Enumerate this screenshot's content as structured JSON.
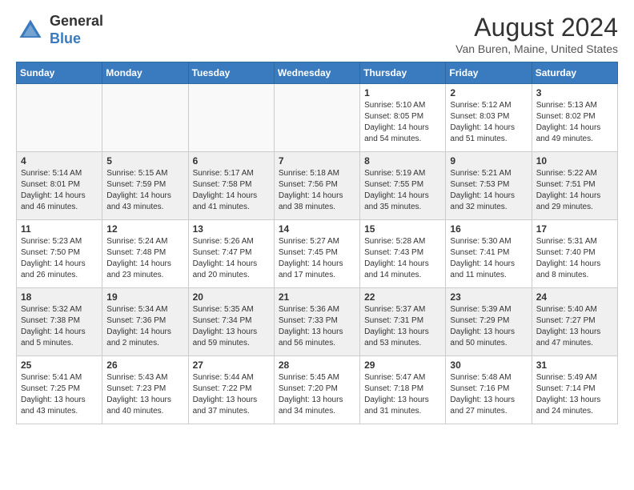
{
  "logo": {
    "line1": "General",
    "line2": "Blue"
  },
  "title": {
    "month_year": "August 2024",
    "location": "Van Buren, Maine, United States"
  },
  "days_of_week": [
    "Sunday",
    "Monday",
    "Tuesday",
    "Wednesday",
    "Thursday",
    "Friday",
    "Saturday"
  ],
  "weeks": [
    [
      {
        "day": "",
        "info": ""
      },
      {
        "day": "",
        "info": ""
      },
      {
        "day": "",
        "info": ""
      },
      {
        "day": "",
        "info": ""
      },
      {
        "day": "1",
        "info": "Sunrise: 5:10 AM\nSunset: 8:05 PM\nDaylight: 14 hours\nand 54 minutes."
      },
      {
        "day": "2",
        "info": "Sunrise: 5:12 AM\nSunset: 8:03 PM\nDaylight: 14 hours\nand 51 minutes."
      },
      {
        "day": "3",
        "info": "Sunrise: 5:13 AM\nSunset: 8:02 PM\nDaylight: 14 hours\nand 49 minutes."
      }
    ],
    [
      {
        "day": "4",
        "info": "Sunrise: 5:14 AM\nSunset: 8:01 PM\nDaylight: 14 hours\nand 46 minutes."
      },
      {
        "day": "5",
        "info": "Sunrise: 5:15 AM\nSunset: 7:59 PM\nDaylight: 14 hours\nand 43 minutes."
      },
      {
        "day": "6",
        "info": "Sunrise: 5:17 AM\nSunset: 7:58 PM\nDaylight: 14 hours\nand 41 minutes."
      },
      {
        "day": "7",
        "info": "Sunrise: 5:18 AM\nSunset: 7:56 PM\nDaylight: 14 hours\nand 38 minutes."
      },
      {
        "day": "8",
        "info": "Sunrise: 5:19 AM\nSunset: 7:55 PM\nDaylight: 14 hours\nand 35 minutes."
      },
      {
        "day": "9",
        "info": "Sunrise: 5:21 AM\nSunset: 7:53 PM\nDaylight: 14 hours\nand 32 minutes."
      },
      {
        "day": "10",
        "info": "Sunrise: 5:22 AM\nSunset: 7:51 PM\nDaylight: 14 hours\nand 29 minutes."
      }
    ],
    [
      {
        "day": "11",
        "info": "Sunrise: 5:23 AM\nSunset: 7:50 PM\nDaylight: 14 hours\nand 26 minutes."
      },
      {
        "day": "12",
        "info": "Sunrise: 5:24 AM\nSunset: 7:48 PM\nDaylight: 14 hours\nand 23 minutes."
      },
      {
        "day": "13",
        "info": "Sunrise: 5:26 AM\nSunset: 7:47 PM\nDaylight: 14 hours\nand 20 minutes."
      },
      {
        "day": "14",
        "info": "Sunrise: 5:27 AM\nSunset: 7:45 PM\nDaylight: 14 hours\nand 17 minutes."
      },
      {
        "day": "15",
        "info": "Sunrise: 5:28 AM\nSunset: 7:43 PM\nDaylight: 14 hours\nand 14 minutes."
      },
      {
        "day": "16",
        "info": "Sunrise: 5:30 AM\nSunset: 7:41 PM\nDaylight: 14 hours\nand 11 minutes."
      },
      {
        "day": "17",
        "info": "Sunrise: 5:31 AM\nSunset: 7:40 PM\nDaylight: 14 hours\nand 8 minutes."
      }
    ],
    [
      {
        "day": "18",
        "info": "Sunrise: 5:32 AM\nSunset: 7:38 PM\nDaylight: 14 hours\nand 5 minutes."
      },
      {
        "day": "19",
        "info": "Sunrise: 5:34 AM\nSunset: 7:36 PM\nDaylight: 14 hours\nand 2 minutes."
      },
      {
        "day": "20",
        "info": "Sunrise: 5:35 AM\nSunset: 7:34 PM\nDaylight: 13 hours\nand 59 minutes."
      },
      {
        "day": "21",
        "info": "Sunrise: 5:36 AM\nSunset: 7:33 PM\nDaylight: 13 hours\nand 56 minutes."
      },
      {
        "day": "22",
        "info": "Sunrise: 5:37 AM\nSunset: 7:31 PM\nDaylight: 13 hours\nand 53 minutes."
      },
      {
        "day": "23",
        "info": "Sunrise: 5:39 AM\nSunset: 7:29 PM\nDaylight: 13 hours\nand 50 minutes."
      },
      {
        "day": "24",
        "info": "Sunrise: 5:40 AM\nSunset: 7:27 PM\nDaylight: 13 hours\nand 47 minutes."
      }
    ],
    [
      {
        "day": "25",
        "info": "Sunrise: 5:41 AM\nSunset: 7:25 PM\nDaylight: 13 hours\nand 43 minutes."
      },
      {
        "day": "26",
        "info": "Sunrise: 5:43 AM\nSunset: 7:23 PM\nDaylight: 13 hours\nand 40 minutes."
      },
      {
        "day": "27",
        "info": "Sunrise: 5:44 AM\nSunset: 7:22 PM\nDaylight: 13 hours\nand 37 minutes."
      },
      {
        "day": "28",
        "info": "Sunrise: 5:45 AM\nSunset: 7:20 PM\nDaylight: 13 hours\nand 34 minutes."
      },
      {
        "day": "29",
        "info": "Sunrise: 5:47 AM\nSunset: 7:18 PM\nDaylight: 13 hours\nand 31 minutes."
      },
      {
        "day": "30",
        "info": "Sunrise: 5:48 AM\nSunset: 7:16 PM\nDaylight: 13 hours\nand 27 minutes."
      },
      {
        "day": "31",
        "info": "Sunrise: 5:49 AM\nSunset: 7:14 PM\nDaylight: 13 hours\nand 24 minutes."
      }
    ]
  ]
}
